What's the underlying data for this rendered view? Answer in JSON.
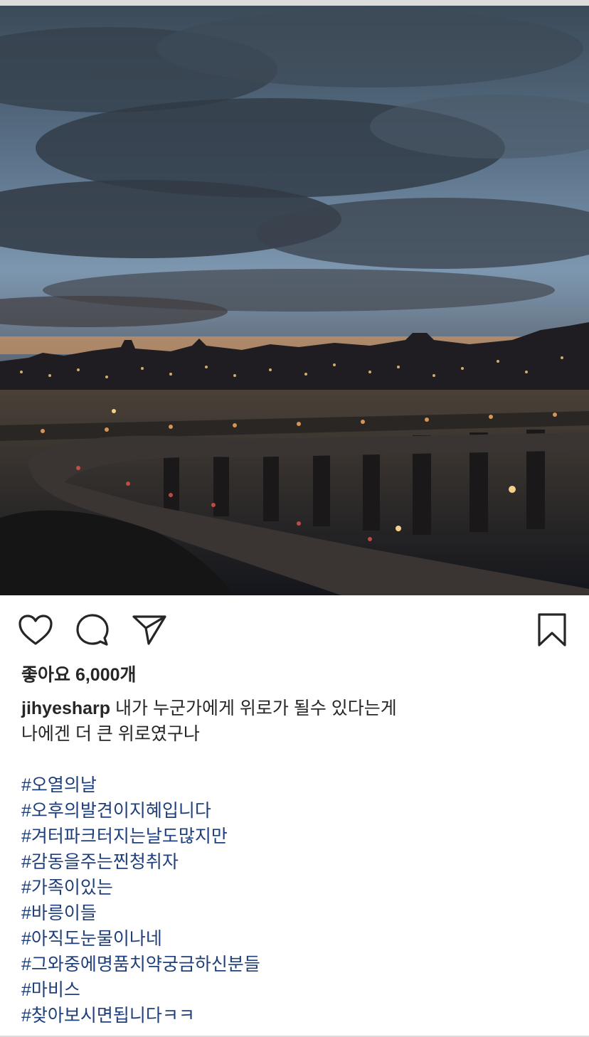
{
  "post": {
    "image": {
      "description_icon": "photo-sunset-river-bridge",
      "colors": {
        "sky_top": "#3f5466",
        "sky_mid": "#6d8aa5",
        "horizon": "#d98a4a",
        "water": "#1b1e26",
        "accent_lights": "#f2c46d"
      }
    },
    "actions": {
      "like_icon": "heart-icon",
      "comment_icon": "comment-icon",
      "share_icon": "send-icon",
      "save_icon": "bookmark-icon"
    },
    "likes_text": "좋아요 6,000개",
    "caption": {
      "username": "jihyesharp",
      "text_line1": " 내가 누군가에게 위로가 될수 있다는게",
      "text_line2": "나에겐 더 큰 위로였구나"
    },
    "hashtags": [
      "#오열의날",
      "#오후의발견이지혜입니다",
      "#겨터파크터지는날도많지만",
      "#감동을주는찐청취자",
      "#가족이있는",
      "#바릉이들",
      "#아직도눈물이나네",
      "#그와중에명품치약궁금하신분들",
      "#마비스",
      "#찾아보시면됩니다ㅋㅋ"
    ]
  }
}
